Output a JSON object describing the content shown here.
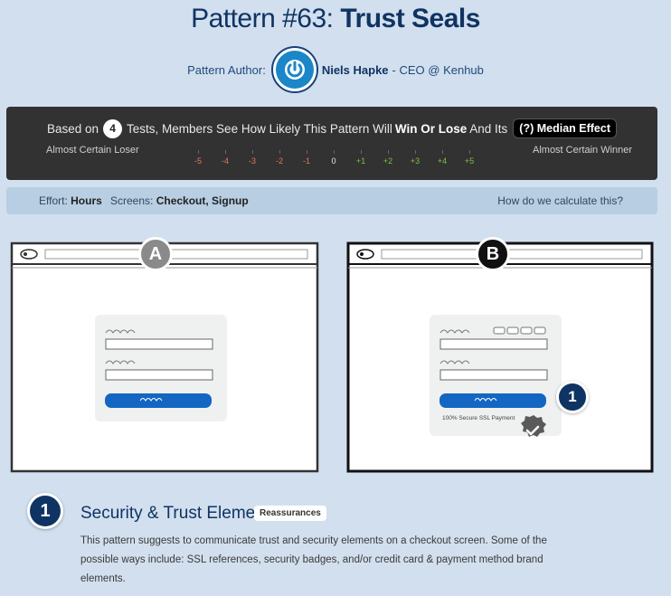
{
  "header": {
    "title_prefix": "Pattern #63:",
    "title_main": "Trust Seals"
  },
  "author": {
    "label": "Pattern Author:",
    "name": "Niels Hapke",
    "role": "- CEO @ Kenhub"
  },
  "score": {
    "based_on": "Based on",
    "tests_count": "4",
    "text_mid": "Tests, Members See How Likely This Pattern Will",
    "win_lose": "Win Or Lose",
    "text_end": "And Its",
    "median_label": "(?) Median Effect",
    "loser_label": "Almost Certain Loser",
    "winner_label": "Almost Certain Winner",
    "scale": [
      "-5",
      "-4",
      "-3",
      "-2",
      "-1",
      "0",
      "+1",
      "+2",
      "+3",
      "+4",
      "+5"
    ]
  },
  "info": {
    "effort_label": "Effort:",
    "effort_value": "Hours",
    "screens_label": "Screens:",
    "screens_value": "Checkout, Signup",
    "calc_link": "How do we calculate this?"
  },
  "variants": {
    "a_label": "A",
    "b_label": "B",
    "b_ssl_text": "100% Secure SSL Payment",
    "b_marker": "1"
  },
  "element": {
    "number": "1",
    "title": "Security & Trust Elements",
    "tag": "Reassurances",
    "description": "This pattern suggests to communicate trust and security elements on a checkout screen. Some of the possible ways include: SSL references, security badges, and/or credit card & payment method brand elements."
  },
  "colors": {
    "background": "#d2dfee",
    "title": "#0f3463",
    "score_bg": "#323232",
    "negative": "#e0785a",
    "positive": "#7bc043",
    "button_blue": "#1466c3"
  }
}
